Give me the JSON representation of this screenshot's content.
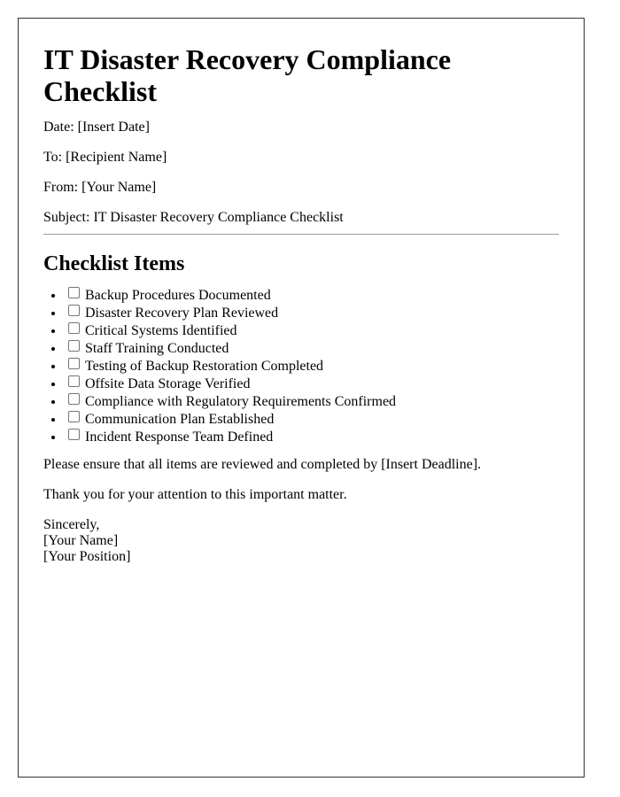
{
  "document": {
    "title": "IT Disaster Recovery Compliance Checklist",
    "meta": {
      "date": "Date: [Insert Date]",
      "to": "To: [Recipient Name]",
      "from": "From: [Your Name]",
      "subject": "Subject: IT Disaster Recovery Compliance Checklist"
    },
    "checklist": {
      "heading": "Checklist Items",
      "items": [
        {
          "label": "Backup Procedures Documented",
          "checked": false
        },
        {
          "label": "Disaster Recovery Plan Reviewed",
          "checked": false
        },
        {
          "label": "Critical Systems Identified",
          "checked": false
        },
        {
          "label": "Staff Training Conducted",
          "checked": false
        },
        {
          "label": "Testing of Backup Restoration Completed",
          "checked": false
        },
        {
          "label": "Offsite Data Storage Verified",
          "checked": false
        },
        {
          "label": "Compliance with Regulatory Requirements Confirmed",
          "checked": false
        },
        {
          "label": "Communication Plan Established",
          "checked": false
        },
        {
          "label": "Incident Response Team Defined",
          "checked": false
        }
      ]
    },
    "body": {
      "instruction": "Please ensure that all items are reviewed and completed by [Insert Deadline].",
      "thanks": "Thank you for your attention to this important matter."
    },
    "signature": {
      "closing": "Sincerely,",
      "name": "[Your Name]",
      "position": "[Your Position]"
    }
  }
}
